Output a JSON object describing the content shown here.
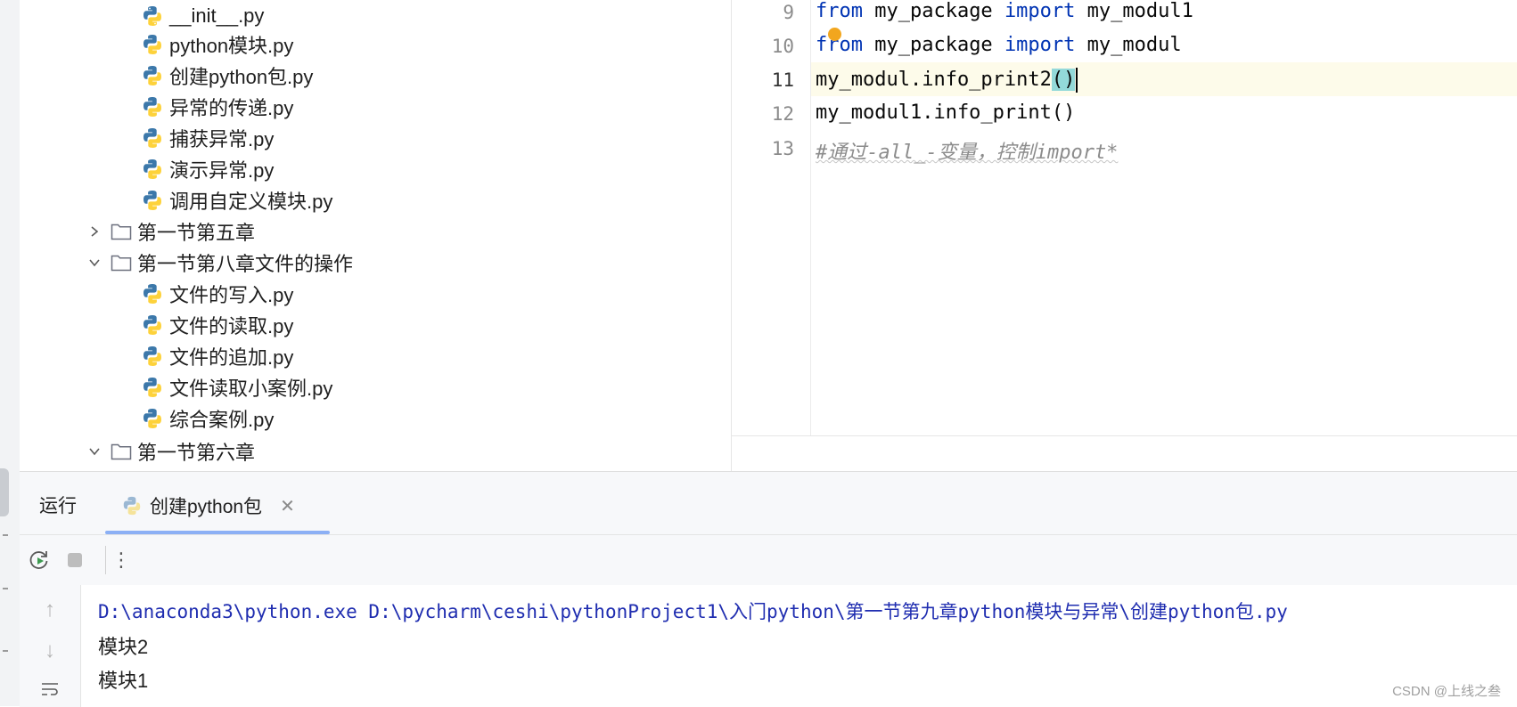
{
  "project_tree": {
    "files_group1": [
      {
        "label": "__init__.py",
        "icon": "python-file-icon"
      },
      {
        "label": "python模块.py",
        "icon": "python-file-icon"
      },
      {
        "label": "创建python包.py",
        "icon": "python-file-icon"
      },
      {
        "label": "异常的传递.py",
        "icon": "python-file-icon"
      },
      {
        "label": "捕获异常.py",
        "icon": "python-file-icon"
      },
      {
        "label": "演示异常.py",
        "icon": "python-file-icon"
      },
      {
        "label": "调用自定义模块.py",
        "icon": "python-file-icon"
      }
    ],
    "folder_collapsed": {
      "label": "第一节第五章",
      "icon": "folder-icon",
      "state": "collapsed"
    },
    "folder_expanded": {
      "label": "第一节第八章文件的操作",
      "icon": "folder-icon",
      "state": "expanded"
    },
    "files_group2": [
      {
        "label": "文件的写入.py",
        "icon": "python-file-icon"
      },
      {
        "label": "文件的读取.py",
        "icon": "python-file-icon"
      },
      {
        "label": "文件的追加.py",
        "icon": "python-file-icon"
      },
      {
        "label": "文件读取小案例.py",
        "icon": "python-file-icon"
      },
      {
        "label": "综合案例.py",
        "icon": "python-file-icon"
      }
    ],
    "folder_last": {
      "label": "第一节第六章",
      "icon": "folder-icon",
      "state": "expanded"
    }
  },
  "editor": {
    "lines": [
      {
        "num": "9",
        "kw1": "from",
        "t1": " my_package ",
        "kw2": "import",
        "t2": " my_modul1"
      },
      {
        "num": "10",
        "kw1": "from",
        "t1": " my_package ",
        "kw2": "import",
        "t2": " my_modul"
      },
      {
        "num": "11",
        "pre": "my_modul.info_print2",
        "hl": "()"
      },
      {
        "num": "12",
        "text": "my_modul1.info_print()"
      },
      {
        "num": "13",
        "comment": "#通过-all_-变量，控制import*"
      }
    ],
    "current_line": "11",
    "intention_bulb": "bulb-icon"
  },
  "run_panel": {
    "title": "运行",
    "tab": {
      "label": "创建python包",
      "icon": "python-file-icon",
      "close": "✕"
    },
    "toolbar": {
      "rerun": "rerun-icon",
      "stop": "stop-icon",
      "more": "⋮"
    },
    "side": {
      "up": "↑",
      "down": "↓",
      "wrap": "soft-wrap-icon"
    },
    "console": {
      "command": "D:\\anaconda3\\python.exe D:\\pycharm\\ceshi\\pythonProject1\\入门python\\第一节第九章python模块与异常\\创建python包.py",
      "output": [
        "模块2",
        "模块1"
      ]
    }
  },
  "watermark": "CSDN @上线之叁",
  "colors": {
    "keyword": "#0033b3",
    "comment": "#8c8c8c",
    "current_line": "#fdfbea",
    "console_cmd": "#1f2db0",
    "accent": "#3574f0"
  }
}
